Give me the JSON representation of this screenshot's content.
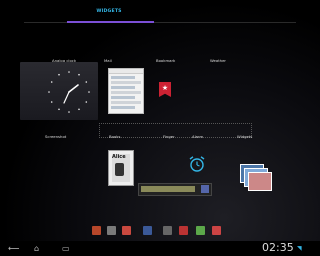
{
  "tabs": {
    "active": "WIDGETS"
  },
  "widgets": {
    "analog_clock": "Analog clock",
    "mail": "Mail",
    "bookmark": "Bookmark",
    "weather": "Weather",
    "screenshot": "Screenshot",
    "books": "Books",
    "finger": "Finger",
    "alarm": "Alarm",
    "gallery": "Widgets",
    "books_cover_title": "Alice"
  },
  "status": {
    "time": "02:35"
  },
  "colors": {
    "accent": "#33b5e5",
    "tab_indicator": "#7b4fd6",
    "bookmark": "#cc2233"
  },
  "nav": {
    "back_icon": "back-icon",
    "home_icon": "home-icon",
    "recents_icon": "recents-icon"
  }
}
